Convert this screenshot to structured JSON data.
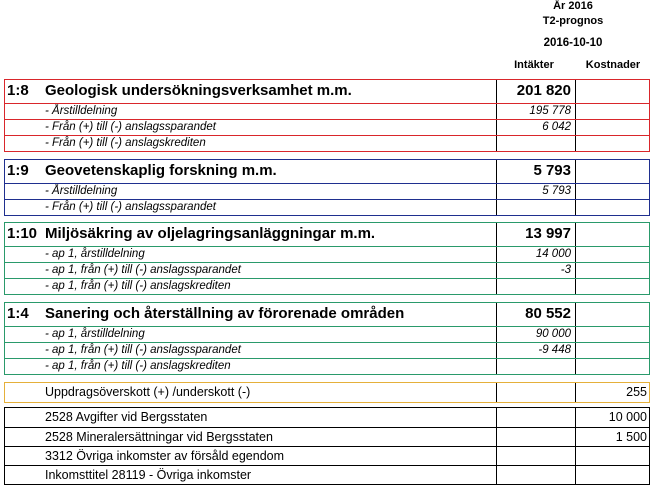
{
  "header": {
    "year": "År 2016",
    "prognosis": "T2-prognos",
    "date": "2016-10-10",
    "col_income": "Intäkter",
    "col_costs": "Kostnader"
  },
  "colors": {
    "block_1_8": "#d9262b",
    "block_1_9": "#1f2f8f",
    "block_1_10": "#2a9a6b",
    "block_1_4": "#2a9a6b",
    "surplus": "#e5b03a",
    "income_titles": "#000000"
  },
  "sections": [
    {
      "code": "1:8",
      "title": "Geologisk undersökningsverksamhet m.m.",
      "income": "201 820",
      "rows": [
        {
          "label": "- Årstilldelning",
          "income": "195 778"
        },
        {
          "label": "- Från (+) till (-) anslagssparandet",
          "income": "6 042"
        },
        {
          "label": "- Från (+) till (-) anslagskrediten",
          "income": ""
        }
      ]
    },
    {
      "code": "1:9",
      "title": "Geovetenskaplig forskning m.m.",
      "income": "5 793",
      "rows": [
        {
          "label": "- Årstilldelning",
          "income": "5 793"
        },
        {
          "label": "- Från (+) till (-) anslagssparandet",
          "income": ""
        }
      ]
    },
    {
      "code": "1:10",
      "title": "Miljösäkring av oljelagringsanläggningar m.m.",
      "income": "13 997",
      "rows": [
        {
          "label": "- ap 1, årstilldelning",
          "income": "14 000"
        },
        {
          "label": "- ap 1, från (+) till (-) anslagssparandet",
          "income": "-3"
        },
        {
          "label": "- ap 1, från (+) till (-) anslagskrediten",
          "income": ""
        }
      ]
    },
    {
      "code": "1:4",
      "title": "Sanering och återställning av förorenade områden",
      "income": "80 552",
      "rows": [
        {
          "label": "- ap 1, årstilldelning",
          "income": "90 000"
        },
        {
          "label": "- ap 1, från (+) till (-) anslagssparandet",
          "income": "-9 448"
        },
        {
          "label": "- ap 1, från (+) till (-) anslagskrediten",
          "income": ""
        }
      ]
    }
  ],
  "surplus": {
    "label": "Uppdragsöverskott (+) /underskott (-)",
    "income": "",
    "costs": "255"
  },
  "other": [
    {
      "label": "2528 Avgifter vid Bergsstaten",
      "income": "",
      "costs": "10 000"
    },
    {
      "label": "2528 Mineralersättningar vid Bergsstaten",
      "income": "",
      "costs": "1 500"
    },
    {
      "label": "3312 Övriga inkomster av försåld egendom",
      "income": "",
      "costs": ""
    },
    {
      "label": "Inkomsttitel 28119 - Övriga inkomster",
      "income": "",
      "costs": ""
    }
  ]
}
